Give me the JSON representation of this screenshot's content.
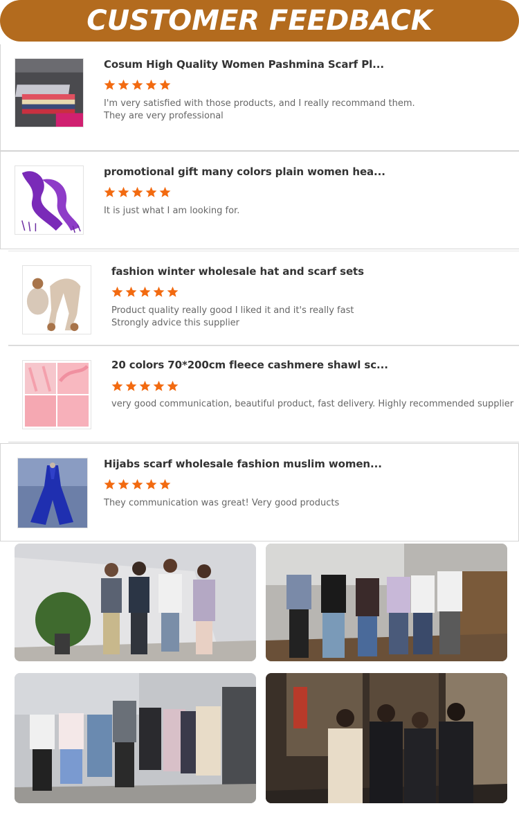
{
  "banner": {
    "title": "CUSTOMER FEEDBACK"
  },
  "rating_color": "#f26a10",
  "reviews": [
    {
      "product": "Cosum High Quality Women Pashmina Scarf Pl...",
      "stars": 5,
      "comment_lines": [
        "I'm very satisfied with those products, and I really recommand them.",
        "They are very professional"
      ],
      "thumb": "folded-scarves-image"
    },
    {
      "product": "promotional gift many colors plain women hea...",
      "stars": 5,
      "comment_lines": [
        "It is just what I am looking for."
      ],
      "thumb": "purple-scarf-image"
    },
    {
      "product": "fashion winter wholesale hat and scarf sets",
      "stars": 5,
      "comment_lines": [
        "Product quality really good I liked it and it's really fast",
        "Strongly advice this supplier"
      ],
      "thumb": "hat-scarf-set-image"
    },
    {
      "product": "20 colors 70*200cm fleece cashmere shawl sc...",
      "stars": 5,
      "comment_lines": [
        "very good communication, beautiful product, fast delivery. Highly recommended supplier"
      ],
      "thumb": "pink-shawl-image"
    },
    {
      "product": "Hijabs scarf wholesale fashion muslim women...",
      "stars": 5,
      "comment_lines": [
        "They communication was great! Very good products"
      ],
      "thumb": "blue-hijab-image"
    }
  ],
  "photos": [
    {
      "name": "team-photo-office-wall"
    },
    {
      "name": "team-photo-cosum-lobby"
    },
    {
      "name": "team-photo-cosum-logo-wall"
    },
    {
      "name": "team-photo-mall-entrance"
    }
  ]
}
